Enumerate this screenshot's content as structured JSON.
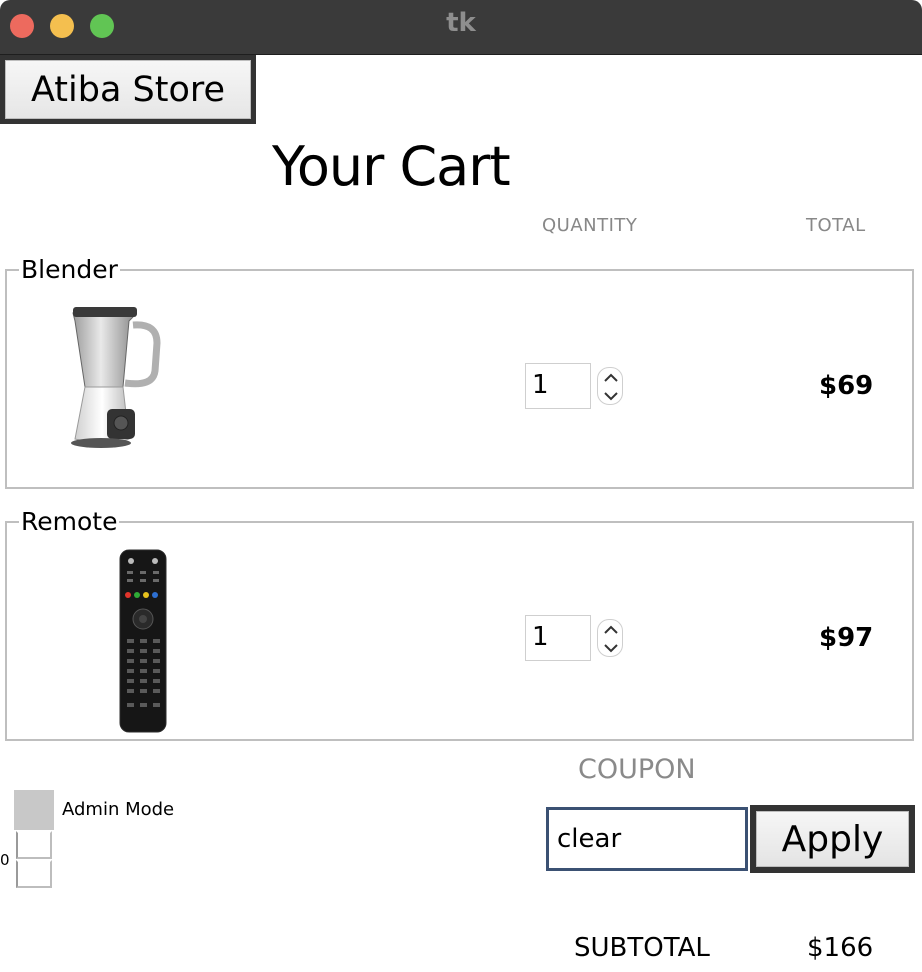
{
  "window": {
    "title": "tk"
  },
  "header": {
    "store_button_label": "Atiba Store",
    "page_title": "Your Cart"
  },
  "columns": {
    "quantity": "QUANTITY",
    "total": "TOTAL"
  },
  "items": [
    {
      "name": "Blender",
      "quantity": "1",
      "total": "$69",
      "image_icon": "blender-image"
    },
    {
      "name": "Remote",
      "quantity": "1",
      "total": "$97",
      "image_icon": "remote-control-image"
    }
  ],
  "coupon": {
    "label": "COUPON",
    "value": "clear",
    "apply_label": "Apply"
  },
  "admin": {
    "label": "Admin Mode",
    "value": "0"
  },
  "summary": {
    "subtotal_label": "SUBTOTAL",
    "subtotal_value": "$166"
  },
  "colors": {
    "titlebar": "#3a3a3a",
    "button_border": "#333333",
    "coupon_focus": "#3b5173",
    "muted_text": "#888888"
  }
}
